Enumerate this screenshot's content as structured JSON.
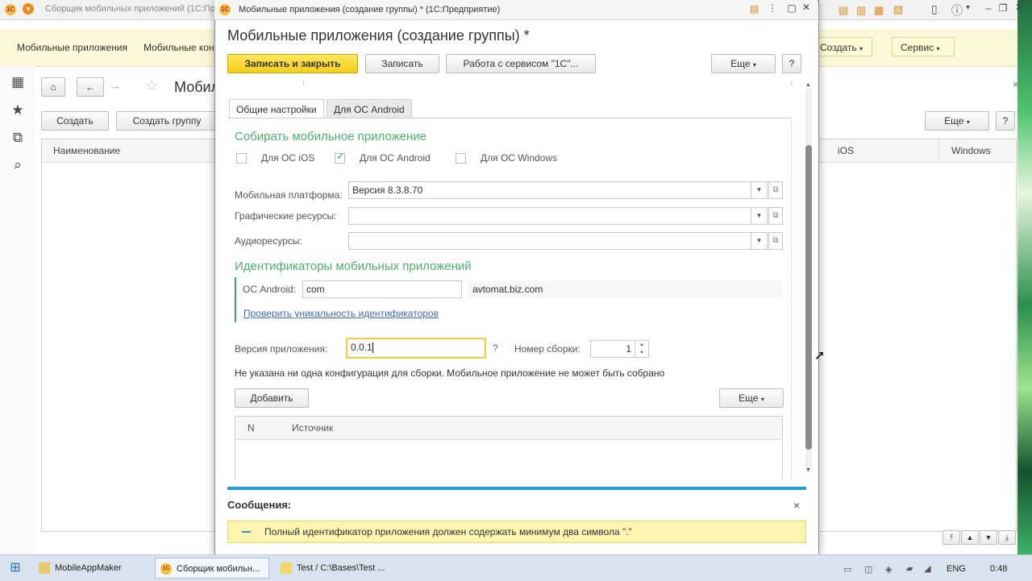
{
  "bg_window": {
    "title": "Сборщик мобильных приложений (1С:Предп",
    "sections": [
      "Мобильные приложения",
      "Мобильные кон"
    ],
    "create_dd": "Создать",
    "service_dd": "Сервис",
    "nav_title": "Мобил",
    "create_btn": "Создать",
    "create_group_btn": "Создать группу",
    "more_btn": "Еще",
    "help_btn": "?",
    "columns": {
      "name": "Наименование",
      "ios": "iOS",
      "windows": "Windows"
    },
    "dots_btn": "..."
  },
  "modal": {
    "title": "Мобильные приложения (создание группы) * (1С:Предприятие)",
    "heading": "Мобильные приложения (создание группы) *",
    "toolbar": {
      "save_close": "Записать и закрыть",
      "save": "Записать",
      "service_work": "Работа с сервисом \"1С\"...",
      "more": "Еще",
      "help": "?"
    },
    "tabs": [
      "Общие настройки",
      "Для ОС Android"
    ],
    "collect_heading": "Собирать мобильное приложение",
    "platforms": [
      {
        "label": "Для ОС iOS",
        "checked": false
      },
      {
        "label": "Для ОС Android",
        "checked": true
      },
      {
        "label": "Для ОС Windows",
        "checked": false
      }
    ],
    "mobile_platform_label": "Мобильная платформа:",
    "mobile_platform_value": "Версия 8.3.8.70",
    "graphics_label": "Графические ресурсы:",
    "graphics_value": "",
    "audio_label": "Аудиоресурсы:",
    "audio_value": "",
    "ids_heading": "Идентификаторы мобильных приложений",
    "android_id_label": "ОС Android:",
    "android_id_value": "com",
    "android_id_suffix": "avtomat.biz.com",
    "check_link": "Проверить уникальность идентификаторов",
    "version_label": "Версия приложения:",
    "version_value": "0.0.1",
    "version_help": "?",
    "build_label": "Номер сборки:",
    "build_value": "1",
    "warning_text": "Не указана ни одна конфигурация для сборки. Мобильное приложение не может быть собрано",
    "add_btn": "Добавить",
    "more_btn": "Еще",
    "table_cols": {
      "n": "N",
      "source": "Источник"
    },
    "messages_title": "Сообщения:",
    "message_text": "Полный идентификатор приложения должен содержать минимум два символа \".\"",
    "close_glyph": "×"
  },
  "taskbar": {
    "items": [
      "MobileAppMaker",
      "Сборщик мобильн...",
      "Test / C:\\Bases\\Test ..."
    ],
    "lang": "ENG",
    "time": "0:48"
  },
  "colors": {
    "accent_green": "#4caf6e",
    "yellow_button": "#f2cf1a",
    "link_blue": "#3f6bb5",
    "message_bar": "#2d9ad8"
  }
}
